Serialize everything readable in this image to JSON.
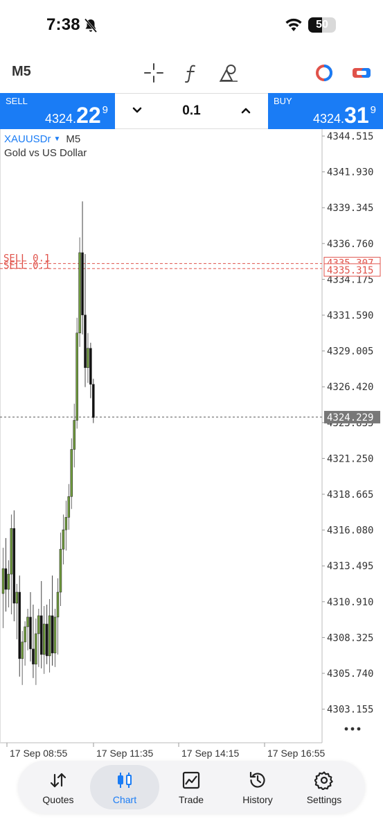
{
  "status": {
    "time": "7:38",
    "battery": "50",
    "battery_level": 0.5
  },
  "toolbar": {
    "timeframe": "M5",
    "icons": [
      "crosshair-icon",
      "function-icon",
      "objects-icon",
      "indicator-toggle-icon",
      "one-click-trading-icon"
    ]
  },
  "trade": {
    "sell_label": "SELL",
    "sell_price_main": "4324.",
    "sell_price_big": "22",
    "sell_price_sup": "9",
    "buy_label": "BUY",
    "buy_price_main": "4324.",
    "buy_price_big": "31",
    "buy_price_sup": "9",
    "volume": "0.1"
  },
  "chart": {
    "symbol": "XAUUSDr",
    "timeframe": "M5",
    "description": "Gold vs US Dollar",
    "colors": {
      "bull": "#6f9a3d",
      "bear": "#111111",
      "order": "#e0524a",
      "accent": "#1a7cf5",
      "current_tag": "#777777"
    },
    "order_labels": [
      "SELL 0.1",
      "SELL 0.1"
    ],
    "order_tag": "4335.315",
    "order_tag_hidden": "4335.307",
    "current_price_tag": "4324.229",
    "current_price": 4324.229,
    "order_prices": [
      4335.315,
      4334.95
    ]
  },
  "chart_data": {
    "type": "candlestick",
    "title": "",
    "y_ticks": [
      "4344.515",
      "4341.930",
      "4339.345",
      "4336.760",
      "4334.175",
      "4331.590",
      "4329.005",
      "4326.420",
      "4323.835",
      "4321.250",
      "4318.665",
      "4316.080",
      "4313.495",
      "4310.910",
      "4308.325",
      "4305.740",
      "4303.155"
    ],
    "x_ticks": [
      "17 Sep 08:55",
      "17 Sep 11:35",
      "17 Sep 14:15",
      "17 Sep 16:55"
    ],
    "ylim": [
      4302.0,
      4345.5
    ],
    "candles": [
      {
        "o": 4311.5,
        "h": 4314.8,
        "l": 4309.0,
        "c": 4313.3
      },
      {
        "o": 4313.3,
        "h": 4315.5,
        "l": 4310.2,
        "c": 4311.8
      },
      {
        "o": 4311.8,
        "h": 4313.9,
        "l": 4310.5,
        "c": 4312.9
      },
      {
        "o": 4312.9,
        "h": 4317.2,
        "l": 4310.0,
        "c": 4316.2
      },
      {
        "o": 4316.2,
        "h": 4317.5,
        "l": 4309.5,
        "c": 4310.8
      },
      {
        "o": 4310.8,
        "h": 4312.2,
        "l": 4308.2,
        "c": 4311.6
      },
      {
        "o": 4311.6,
        "h": 4312.8,
        "l": 4305.5,
        "c": 4306.8
      },
      {
        "o": 4306.8,
        "h": 4308.8,
        "l": 4304.9,
        "c": 4308.0
      },
      {
        "o": 4308.0,
        "h": 4309.5,
        "l": 4306.3,
        "c": 4309.1
      },
      {
        "o": 4309.1,
        "h": 4310.4,
        "l": 4307.4,
        "c": 4309.8
      },
      {
        "o": 4309.8,
        "h": 4311.6,
        "l": 4306.6,
        "c": 4307.5
      },
      {
        "o": 4307.5,
        "h": 4310.7,
        "l": 4305.4,
        "c": 4306.4
      },
      {
        "o": 4306.4,
        "h": 4309.7,
        "l": 4304.9,
        "c": 4308.6
      },
      {
        "o": 4308.6,
        "h": 4310.4,
        "l": 4306.2,
        "c": 4309.9
      },
      {
        "o": 4309.9,
        "h": 4312.4,
        "l": 4306.1,
        "c": 4307.1
      },
      {
        "o": 4307.1,
        "h": 4310.6,
        "l": 4305.7,
        "c": 4309.3
      },
      {
        "o": 4309.3,
        "h": 4310.7,
        "l": 4306.4,
        "c": 4307.0
      },
      {
        "o": 4307.0,
        "h": 4311.1,
        "l": 4305.8,
        "c": 4309.9
      },
      {
        "o": 4309.9,
        "h": 4312.8,
        "l": 4306.3,
        "c": 4307.2
      },
      {
        "o": 4307.2,
        "h": 4310.4,
        "l": 4306.2,
        "c": 4309.8
      },
      {
        "o": 4309.8,
        "h": 4312.6,
        "l": 4307.1,
        "c": 4311.6
      },
      {
        "o": 4311.6,
        "h": 4315.9,
        "l": 4310.6,
        "c": 4314.7
      },
      {
        "o": 4314.7,
        "h": 4317.2,
        "l": 4313.6,
        "c": 4316.1
      },
      {
        "o": 4316.1,
        "h": 4318.2,
        "l": 4314.6,
        "c": 4317.0
      },
      {
        "o": 4317.0,
        "h": 4319.4,
        "l": 4316.1,
        "c": 4318.5
      },
      {
        "o": 4318.5,
        "h": 4322.7,
        "l": 4317.6,
        "c": 4321.9
      },
      {
        "o": 4321.9,
        "h": 4325.2,
        "l": 4320.6,
        "c": 4324.0
      },
      {
        "o": 4324.0,
        "h": 4331.4,
        "l": 4323.4,
        "c": 4330.3
      },
      {
        "o": 4330.3,
        "h": 4337.2,
        "l": 4329.3,
        "c": 4336.1
      },
      {
        "o": 4336.1,
        "h": 4339.8,
        "l": 4330.2,
        "c": 4331.6
      },
      {
        "o": 4331.6,
        "h": 4336.0,
        "l": 4326.4,
        "c": 4327.8
      },
      {
        "o": 4327.8,
        "h": 4330.3,
        "l": 4326.7,
        "c": 4329.2
      },
      {
        "o": 4329.2,
        "h": 4329.6,
        "l": 4325.6,
        "c": 4326.6
      },
      {
        "o": 4326.6,
        "h": 4327.0,
        "l": 4323.8,
        "c": 4324.2
      }
    ]
  },
  "nav": {
    "items": [
      {
        "label": "Quotes",
        "icon": "quotes-icon"
      },
      {
        "label": "Chart",
        "icon": "chart-icon"
      },
      {
        "label": "Trade",
        "icon": "trade-icon"
      },
      {
        "label": "History",
        "icon": "history-icon"
      },
      {
        "label": "Settings",
        "icon": "settings-icon"
      }
    ],
    "active": "Chart"
  }
}
